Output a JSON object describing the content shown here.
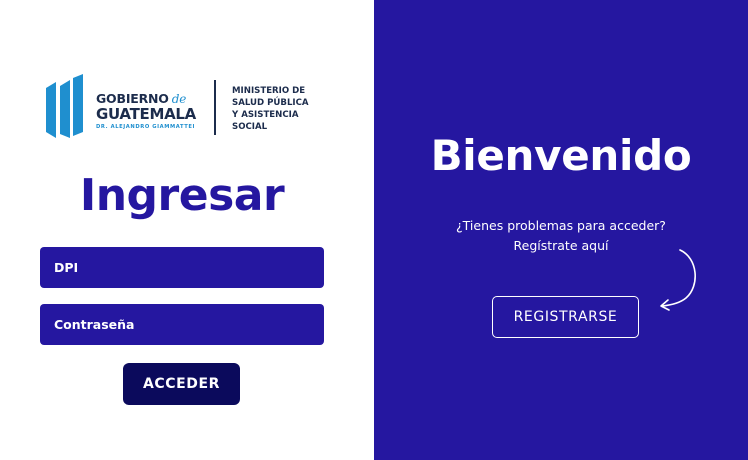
{
  "logo": {
    "line1": "GOBIERNO",
    "line1_de": "de",
    "line2": "GUATEMALA",
    "line3": "DR. ALEJANDRO GIAMMATTEI",
    "ministry": [
      "MINISTERIO DE",
      "SALUD PÚBLICA",
      "Y ASISTENCIA",
      "SOCIAL"
    ]
  },
  "login": {
    "title": "Ingresar",
    "dpi_placeholder": "DPI",
    "password_placeholder": "Contraseña",
    "submit_label": "ACCEDER"
  },
  "welcome": {
    "title": "Bienvenido",
    "help_line1": "¿Tienes problemas para acceder?",
    "help_line2": "Regístrate aquí",
    "register_label": "REGISTRARSE"
  },
  "colors": {
    "primary": "#2517a0",
    "button_dark": "#0b0a5c",
    "logo_blue": "#1f8fcf",
    "logo_navy": "#1c2c4c",
    "white": "#ffffff"
  },
  "icons": {
    "logo_mark": "guatemala-flag-bars-icon",
    "arrow": "curved-arrow-icon"
  }
}
